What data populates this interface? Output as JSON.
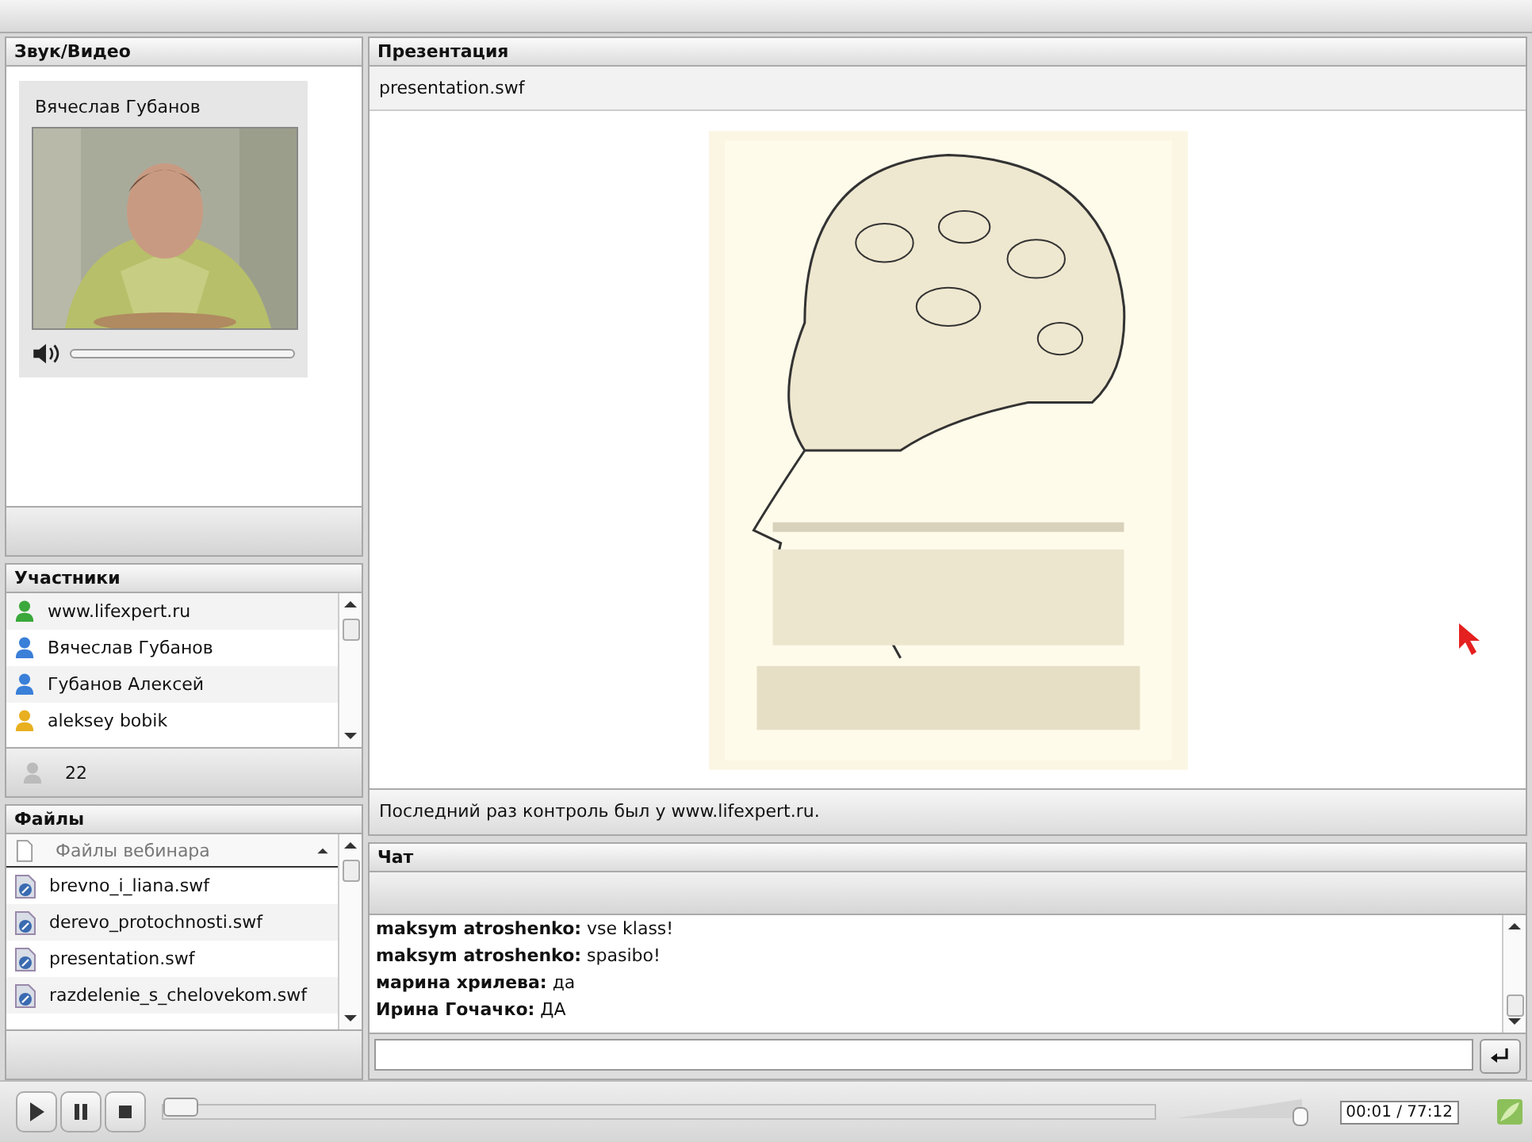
{
  "video_panel": {
    "title": "Звук/Видео",
    "speaker": "Вячеслав Губанов",
    "audio": {
      "level": 0.0
    }
  },
  "participants": {
    "title": "Участники",
    "items": [
      {
        "name": "www.lifexpert.ru",
        "color": "#3aa83a"
      },
      {
        "name": "Вячеслав Губанов",
        "color": "#3a7fd8"
      },
      {
        "name": "Губанов Алексей",
        "color": "#3a7fd8"
      },
      {
        "name": "aleksey bobik",
        "color": "#e8b020"
      }
    ],
    "count": "22"
  },
  "files": {
    "title": "Файлы",
    "header": "Файлы вебинара",
    "items": [
      "brevno_i_liana.swf",
      "derevo_protochnosti.swf",
      "presentation.swf",
      "razdelenie_s_chelovekom.swf"
    ]
  },
  "presentation": {
    "title": "Презентация",
    "file": "presentation.swf",
    "status": "Последний раз контроль был у www.lifexpert.ru."
  },
  "chat": {
    "title": "Чат",
    "messages": [
      {
        "author": "maksym atroshenko:",
        "text": "vse klass!"
      },
      {
        "author": "maksym atroshenko:",
        "text": "spasibo!"
      },
      {
        "author": "марина хрилева:",
        "text": "да"
      },
      {
        "author": "Ирина Гочачко:",
        "text": "ДА"
      }
    ]
  },
  "player": {
    "progress": {
      "level": 0.0
    },
    "volume": {
      "level": 1.0
    },
    "time": "00:01 / 77:12"
  }
}
